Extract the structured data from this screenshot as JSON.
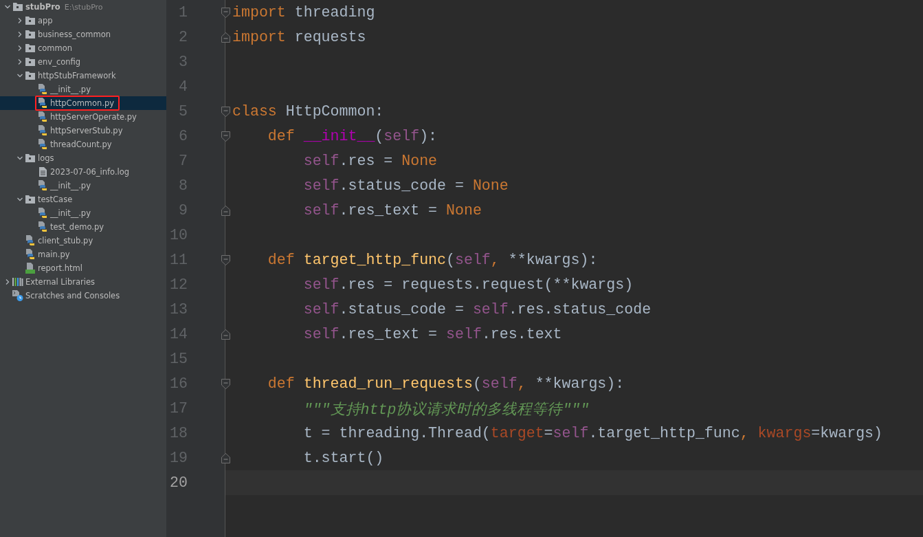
{
  "project_tree": [
    {
      "label": "stubPro",
      "path": "E:\\stubPro",
      "kind": "folder",
      "expanded": true,
      "selected": false,
      "annotated": false,
      "children": [
        {
          "label": "app",
          "kind": "folder",
          "expanded": false,
          "selected": false,
          "annotated": false
        },
        {
          "label": "business_common",
          "kind": "folder",
          "expanded": false,
          "selected": false,
          "annotated": false
        },
        {
          "label": "common",
          "kind": "folder",
          "expanded": false,
          "selected": false,
          "annotated": false
        },
        {
          "label": "env_config",
          "kind": "folder",
          "expanded": false,
          "selected": false,
          "annotated": false
        },
        {
          "label": "httpStubFramework",
          "kind": "folder",
          "expanded": true,
          "selected": false,
          "annotated": false,
          "children": [
            {
              "label": "__init__.py",
              "kind": "python",
              "selected": false,
              "annotated": false
            },
            {
              "label": "httpCommon.py",
              "kind": "python",
              "selected": true,
              "annotated": true
            },
            {
              "label": "httpServerOperate.py",
              "kind": "python",
              "selected": false,
              "annotated": false
            },
            {
              "label": "httpServerStub.py",
              "kind": "python",
              "selected": false,
              "annotated": false
            },
            {
              "label": "threadCount.py",
              "kind": "python",
              "selected": false,
              "annotated": false
            }
          ]
        },
        {
          "label": "logs",
          "kind": "folder",
          "expanded": true,
          "selected": false,
          "annotated": false,
          "children": [
            {
              "label": "2023-07-06_info.log",
              "kind": "log",
              "selected": false,
              "annotated": false
            },
            {
              "label": "__init__.py",
              "kind": "python",
              "selected": false,
              "annotated": false
            }
          ]
        },
        {
          "label": "testCase",
          "kind": "folder",
          "expanded": true,
          "selected": false,
          "annotated": false,
          "children": [
            {
              "label": "__init__.py",
              "kind": "python",
              "selected": false,
              "annotated": false
            },
            {
              "label": "test_demo.py",
              "kind": "python",
              "selected": false,
              "annotated": false
            }
          ]
        },
        {
          "label": "client_stub.py",
          "kind": "python",
          "selected": false,
          "annotated": false
        },
        {
          "label": "main.py",
          "kind": "python",
          "selected": false,
          "annotated": false
        },
        {
          "label": "report.html",
          "kind": "html",
          "selected": false,
          "annotated": false
        }
      ]
    },
    {
      "label": "External Libraries",
      "kind": "libraries",
      "expanded": false,
      "selected": false,
      "annotated": false
    },
    {
      "label": "Scratches and Consoles",
      "kind": "scratches",
      "selected": false,
      "annotated": false
    }
  ],
  "editor": {
    "lines": [
      {
        "number": "1",
        "fold_start": true,
        "fold_end": false,
        "tokens": [
          {
            "kind": "keyword",
            "text": "import "
          },
          {
            "kind": "plain",
            "text": "threading"
          }
        ]
      },
      {
        "number": "2",
        "fold_start": false,
        "fold_end": true,
        "tokens": [
          {
            "kind": "keyword",
            "text": "import "
          },
          {
            "kind": "plain",
            "text": "requests"
          }
        ]
      },
      {
        "number": "3",
        "fold_start": false,
        "fold_end": false
      },
      {
        "number": "4",
        "fold_start": false,
        "fold_end": false
      },
      {
        "number": "5",
        "fold_start": true,
        "fold_end": false,
        "tokens": [
          {
            "kind": "keyword",
            "text": "class "
          },
          {
            "kind": "plain",
            "text": "HttpCommon:"
          }
        ]
      },
      {
        "number": "6",
        "fold_start": true,
        "fold_end": false,
        "tokens": [
          {
            "kind": "keyword",
            "text": "    def "
          },
          {
            "kind": "magic",
            "text": "__init__"
          },
          {
            "kind": "plain",
            "text": "("
          },
          {
            "kind": "self",
            "text": "self"
          },
          {
            "kind": "plain",
            "text": "):"
          }
        ]
      },
      {
        "number": "7",
        "fold_start": false,
        "fold_end": false,
        "tokens": [
          {
            "kind": "self",
            "text": "        self"
          },
          {
            "kind": "plain",
            "text": ".res = "
          },
          {
            "kind": "keyword",
            "text": "None"
          }
        ]
      },
      {
        "number": "8",
        "fold_start": false,
        "fold_end": false,
        "tokens": [
          {
            "kind": "self",
            "text": "        self"
          },
          {
            "kind": "plain",
            "text": ".status_code = "
          },
          {
            "kind": "keyword",
            "text": "None"
          }
        ]
      },
      {
        "number": "9",
        "fold_start": false,
        "fold_end": true,
        "tokens": [
          {
            "kind": "self",
            "text": "        self"
          },
          {
            "kind": "plain",
            "text": ".res_text = "
          },
          {
            "kind": "keyword",
            "text": "None"
          }
        ]
      },
      {
        "number": "10",
        "fold_start": false,
        "fold_end": false
      },
      {
        "number": "11",
        "fold_start": true,
        "fold_end": false,
        "tokens": [
          {
            "kind": "keyword",
            "text": "    def "
          },
          {
            "kind": "function",
            "text": "target_http_func"
          },
          {
            "kind": "plain",
            "text": "("
          },
          {
            "kind": "self",
            "text": "self"
          },
          {
            "kind": "keyword",
            "text": ", "
          },
          {
            "kind": "plain",
            "text": "**kwargs):"
          }
        ]
      },
      {
        "number": "12",
        "fold_start": false,
        "fold_end": false,
        "tokens": [
          {
            "kind": "self",
            "text": "        self"
          },
          {
            "kind": "plain",
            "text": ".res = requests.request(**kwargs)"
          }
        ]
      },
      {
        "number": "13",
        "fold_start": false,
        "fold_end": false,
        "tokens": [
          {
            "kind": "self",
            "text": "        self"
          },
          {
            "kind": "plain",
            "text": ".status_code = "
          },
          {
            "kind": "self",
            "text": "self"
          },
          {
            "kind": "plain",
            "text": ".res.status_code"
          }
        ]
      },
      {
        "number": "14",
        "fold_start": false,
        "fold_end": true,
        "tokens": [
          {
            "kind": "self",
            "text": "        self"
          },
          {
            "kind": "plain",
            "text": ".res_text = "
          },
          {
            "kind": "self",
            "text": "self"
          },
          {
            "kind": "plain",
            "text": ".res.text"
          }
        ]
      },
      {
        "number": "15",
        "fold_start": false,
        "fold_end": false
      },
      {
        "number": "16",
        "fold_start": true,
        "fold_end": false,
        "tokens": [
          {
            "kind": "keyword",
            "text": "    def "
          },
          {
            "kind": "function",
            "text": "thread_run_requests"
          },
          {
            "kind": "plain",
            "text": "("
          },
          {
            "kind": "self",
            "text": "self"
          },
          {
            "kind": "keyword",
            "text": ", "
          },
          {
            "kind": "plain",
            "text": "**kwargs):"
          }
        ]
      },
      {
        "number": "17",
        "fold_start": false,
        "fold_end": false,
        "tokens": [
          {
            "kind": "docstring",
            "text": "        \"\"\"支持http协议请求时的多线程等待\"\"\""
          }
        ]
      },
      {
        "number": "18",
        "fold_start": false,
        "fold_end": false,
        "tokens": [
          {
            "kind": "plain",
            "text": "        t = threading.Thread("
          },
          {
            "kind": "param",
            "text": "target"
          },
          {
            "kind": "plain",
            "text": "="
          },
          {
            "kind": "self",
            "text": "self"
          },
          {
            "kind": "plain",
            "text": ".target_http_func"
          },
          {
            "kind": "keyword",
            "text": ", "
          },
          {
            "kind": "param",
            "text": "kwargs"
          },
          {
            "kind": "plain",
            "text": "=kwargs)"
          }
        ]
      },
      {
        "number": "19",
        "fold_start": false,
        "fold_end": true,
        "tokens": [
          {
            "kind": "plain",
            "text": "        t.start()"
          }
        ]
      },
      {
        "number": "20",
        "fold_start": false,
        "fold_end": false,
        "current": true
      }
    ]
  }
}
